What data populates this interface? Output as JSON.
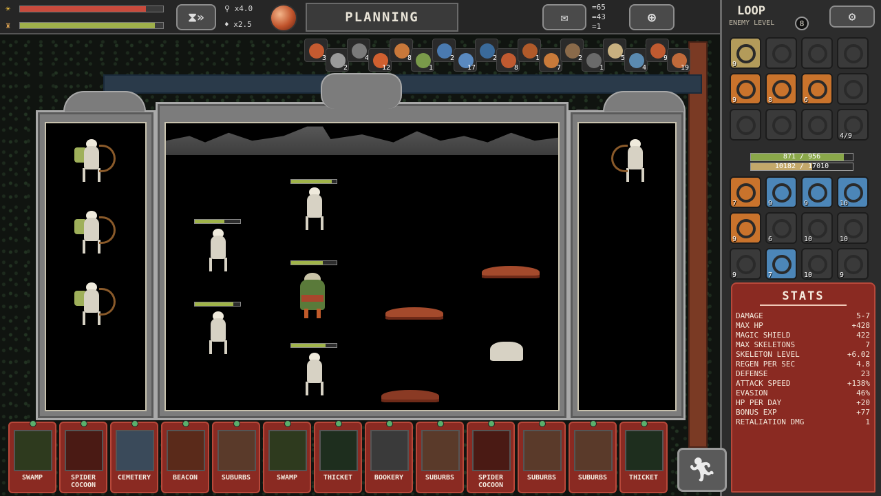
{
  "topbar": {
    "speed_top": "x4.0",
    "speed_bottom": "x2.5",
    "phase_label": "PLANNING",
    "resources": [
      "=65",
      "=43",
      "=1"
    ],
    "loop_title": "LOOP",
    "enemy_level_label": "ENEMY LEVEL",
    "enemy_level": "8",
    "icons": {
      "sun": "sun-icon",
      "lamp": "lamp-icon",
      "hourglass": "hourglass-fastforward-icon",
      "settings": "gear-icon",
      "map": "map-scroll-icon",
      "crosshair": "crosshair-icon"
    }
  },
  "player_bars": {
    "hp_fill": 0.88,
    "exp_fill": 0.94,
    "hp_color": "#c94a3c",
    "exp_color": "#9fb04a"
  },
  "loot": [
    {
      "count": "3",
      "color": "#c45a30"
    },
    {
      "count": "2",
      "color": "#9a9a9a"
    },
    {
      "count": "4",
      "color": "#7a7a7a"
    },
    {
      "count": "12",
      "color": "#d06030"
    },
    {
      "count": "8",
      "color": "#c8783a"
    },
    {
      "count": "1",
      "color": "#7a9a4a"
    },
    {
      "count": "2",
      "color": "#4a7ab0"
    },
    {
      "count": "17",
      "color": "#5a8ac0"
    },
    {
      "count": "2",
      "color": "#3a6a9a"
    },
    {
      "count": "8",
      "color": "#c05a30"
    },
    {
      "count": "1",
      "color": "#b05a2a"
    },
    {
      "count": "7",
      "color": "#c87a3a"
    },
    {
      "count": "2",
      "color": "#8a6a4a"
    },
    {
      "count": "1",
      "color": "#6a6a6a"
    },
    {
      "count": "5",
      "color": "#c8b080"
    },
    {
      "count": "4",
      "color": "#5a8ab0"
    },
    {
      "count": "9",
      "color": "#c05a30"
    },
    {
      "count": "19",
      "color": "#c06a3a"
    },
    {
      "count": "2",
      "color": "#4a7ab0"
    }
  ],
  "equipment": [
    {
      "count": "9",
      "tone": "gold"
    },
    {
      "count": "",
      "tone": "dim"
    },
    {
      "count": "",
      "tone": "dim"
    },
    {
      "count": "",
      "tone": "dim"
    },
    {
      "count": "9",
      "tone": "orange"
    },
    {
      "count": "8",
      "tone": "orange"
    },
    {
      "count": "6",
      "tone": "orange"
    },
    {
      "count": "",
      "tone": "dim"
    },
    {
      "count": "",
      "tone": "dim"
    },
    {
      "count": "",
      "tone": "dim"
    },
    {
      "count": "",
      "tone": "dim"
    },
    {
      "count": "4/9",
      "tone": "dim"
    }
  ],
  "hero_bars": {
    "hp_text": "871 / 956",
    "hp_fill": 0.91,
    "exp_text": "10182 / 17010",
    "exp_fill": 0.6
  },
  "inventory": [
    {
      "count": "7",
      "tone": "orange"
    },
    {
      "count": "9",
      "tone": "blue"
    },
    {
      "count": "9",
      "tone": "blue"
    },
    {
      "count": "10",
      "tone": "blue"
    },
    {
      "count": "9",
      "tone": "orange"
    },
    {
      "count": "6",
      "tone": "dim"
    },
    {
      "count": "10",
      "tone": "dim"
    },
    {
      "count": "10",
      "tone": "dim"
    },
    {
      "count": "9",
      "tone": "dim"
    },
    {
      "count": "7",
      "tone": "blue"
    },
    {
      "count": "10",
      "tone": "dim"
    },
    {
      "count": "9",
      "tone": "dim"
    }
  ],
  "stats": {
    "title": "STATS",
    "rows": [
      {
        "label": "DAMAGE",
        "value": "5-7"
      },
      {
        "label": "MAX HP",
        "value": "+428"
      },
      {
        "label": "MAGIC SHIELD",
        "value": "422"
      },
      {
        "label": "MAX SKELETONS",
        "value": "7"
      },
      {
        "label": "SKELETON LEVEL",
        "value": "+6.02"
      },
      {
        "label": "REGEN PER SEC",
        "value": "4.8"
      },
      {
        "label": "DEFENSE",
        "value": "23"
      },
      {
        "label": "ATTACK SPEED",
        "value": "+138%"
      },
      {
        "label": "EVASION",
        "value": "46%"
      },
      {
        "label": "HP PER DAY",
        "value": "+20"
      },
      {
        "label": "BONUS EXP",
        "value": "+77"
      },
      {
        "label": "RETALIATION DMG",
        "value": "1"
      }
    ]
  },
  "cards": [
    {
      "label": "SWAMP",
      "art": "#2e3a1e"
    },
    {
      "label": "SPIDER COCOON",
      "art": "#4a1a14"
    },
    {
      "label": "CEMETERY",
      "art": "#3a4a5a"
    },
    {
      "label": "BEACON",
      "art": "#5a2a1a"
    },
    {
      "label": "SUBURBS",
      "art": "#5a3a2a"
    },
    {
      "label": "SWAMP",
      "art": "#2e3a1e"
    },
    {
      "label": "THICKET",
      "art": "#1e2e1e"
    },
    {
      "label": "BOOKERY",
      "art": "#3a3a3a"
    },
    {
      "label": "SUBURBS",
      "art": "#5a3a2a"
    },
    {
      "label": "SPIDER COCOON",
      "art": "#4a1a14"
    },
    {
      "label": "SUBURBS",
      "art": "#5a3a2a"
    },
    {
      "label": "SUBURBS",
      "art": "#5a3a2a"
    },
    {
      "label": "THICKET",
      "art": "#1e2e1e"
    }
  ],
  "battle": {
    "side_hp": [
      0.9,
      0.65,
      0.7,
      0.85,
      0.75
    ],
    "retreat_icon": "running-man-icon"
  }
}
